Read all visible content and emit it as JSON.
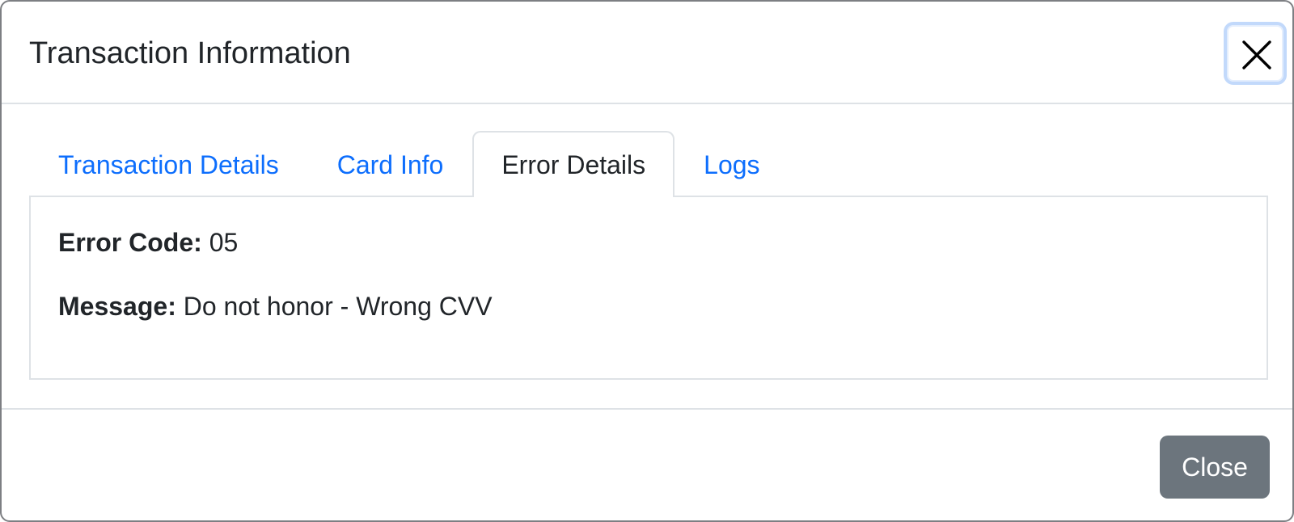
{
  "modal": {
    "title": "Transaction Information"
  },
  "tabs": [
    {
      "label": "Transaction Details",
      "active": false
    },
    {
      "label": "Card Info",
      "active": false
    },
    {
      "label": "Error Details",
      "active": true
    },
    {
      "label": "Logs",
      "active": false
    }
  ],
  "error_details": {
    "code_label": "Error Code:",
    "code_value": "05",
    "message_label": "Message:",
    "message_value": "Do not honor - Wrong CVV"
  },
  "footer": {
    "close_label": "Close"
  },
  "icons": {
    "header_close": "close-icon"
  },
  "colors": {
    "link": "#0d6efd",
    "text": "#212529",
    "secondary_button": "#6c757d",
    "focus_ring": "#c2d9fb",
    "border": "#dee2e6"
  }
}
